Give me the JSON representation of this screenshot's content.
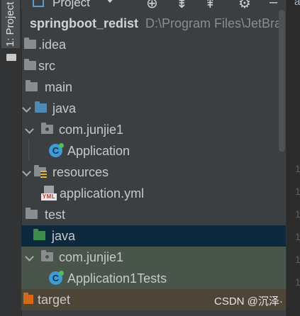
{
  "sidebar": {
    "tool_window_label": "1: Project"
  },
  "header": {
    "title": "Project"
  },
  "tree": {
    "root_name": "springboot_redist",
    "root_path": "D:\\Program Files\\JetBra",
    "items": [
      {
        "label": "springboot_redist"
      },
      {
        "label": ".idea"
      },
      {
        "label": "src"
      },
      {
        "label": "main"
      },
      {
        "label": "java"
      },
      {
        "label": "com.junjie1"
      },
      {
        "label": "Application"
      },
      {
        "label": "resources"
      },
      {
        "label": "application.yml"
      },
      {
        "label": "test"
      },
      {
        "label": "java"
      },
      {
        "label": "com.junjie1"
      },
      {
        "label": "Application1Tests"
      },
      {
        "label": "target"
      }
    ]
  },
  "icons": {
    "yml_badge": "YML",
    "class_glyph": "C"
  },
  "gutter": {
    "line_numbers": [
      "1",
      "1",
      "1",
      "1",
      "1",
      "1"
    ],
    "editor_fragment": "a"
  },
  "watermark": "CSDN @沉泽·",
  "colors": {
    "selection": "#0d293e",
    "test_highlight": "#49544a",
    "source_folder": "#4a8ab4",
    "test_folder": "#3d8e4a",
    "excluded_folder": "#d36a1b"
  }
}
